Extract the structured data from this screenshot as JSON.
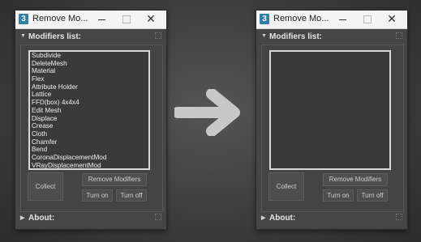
{
  "left_window": {
    "title": "Remove Mo...",
    "app_icon_label": "3",
    "minimize_icon": "minimize-icon",
    "maximize_icon": "maximize-icon",
    "close_glyph": "✕",
    "modifiers_header": "Modifiers list:",
    "modifiers": [
      "Subdivide",
      "DeleteMesh",
      "Material",
      "Flex",
      "Attribute Holder",
      "Lattice",
      "FFD(box) 4x4x4",
      "Edit Mesh",
      "Displace",
      "Crease",
      "Cloth",
      "Chamfer",
      "Bend",
      "CoronaDisplacementMod",
      "VRayDisplacementMod"
    ],
    "collect_label": "Collect",
    "remove_label": "Remove Modifiers",
    "turn_on_label": "Turn on",
    "turn_off_label": "Turn off",
    "about_header": "About:"
  },
  "right_window": {
    "title": "Remove Mo...",
    "app_icon_label": "3",
    "close_glyph": "✕",
    "modifiers_header": "Modifiers list:",
    "modifiers": [],
    "collect_label": "Collect",
    "remove_label": "Remove Modifiers",
    "turn_on_label": "Turn on",
    "turn_off_label": "Turn off",
    "about_header": "About:"
  },
  "colors": {
    "background": "#3e3e3e",
    "panel": "#454545",
    "titlebar": "#f3f3f3",
    "list_border": "#d8d8d8",
    "arrow": "#c8c8c8"
  },
  "icons": {
    "transition_arrow": "right-arrow-icon",
    "collapse_arrow": "triangle-down-icon",
    "expand_arrow": "triangle-right-icon"
  }
}
